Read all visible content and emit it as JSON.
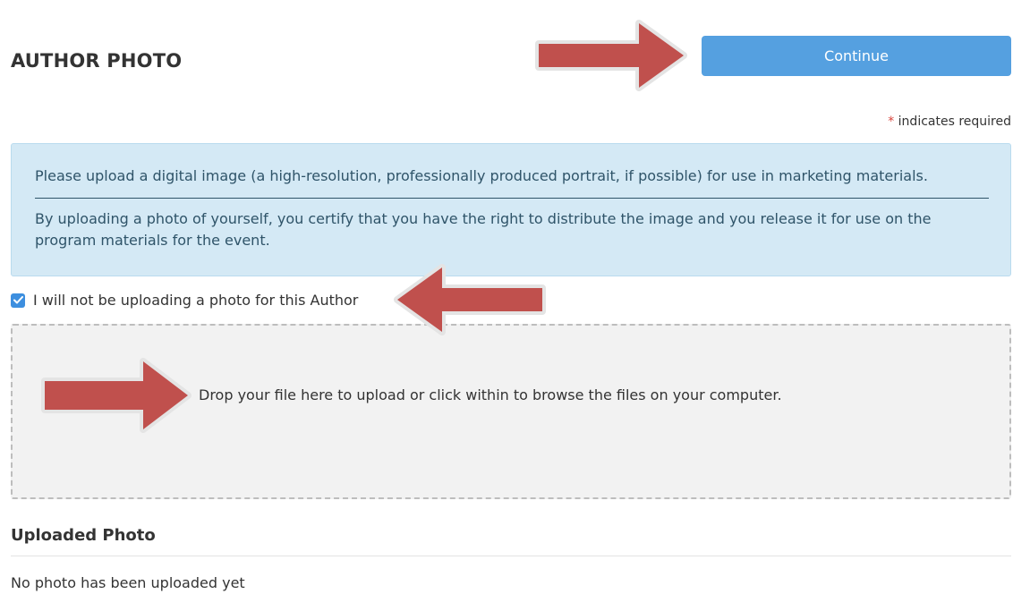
{
  "header": {
    "title": "AUTHOR PHOTO",
    "continue_label": "Continue"
  },
  "required_note": {
    "marker": "*",
    "text": "indicates required"
  },
  "info": {
    "line1": "Please upload a digital image (a high-resolution, professionally produced portrait, if possible) for use in marketing materials.",
    "line2": "By uploading a photo of yourself, you certify that you have the right to distribute the image and you release it for use on the program materials for the event."
  },
  "no_photo_checkbox": {
    "checked": true,
    "label": "I will not be uploading a photo for this Author"
  },
  "dropzone": {
    "text": "Drop your file here to upload or click within to browse the files on your computer."
  },
  "uploaded": {
    "title": "Uploaded Photo",
    "empty_text": "No photo has been uploaded yet"
  },
  "annotations": {
    "arrow_color": "#c0504d",
    "arrows": [
      "arrow-right",
      "arrow-left",
      "arrow-right"
    ]
  },
  "colors": {
    "primary_button": "#55a0e0",
    "info_background": "#d4e9f5",
    "info_text": "#2f5469",
    "required_star": "#d9453d",
    "checkbox": "#3d8fdf",
    "dropzone_background": "#f2f2f2"
  }
}
